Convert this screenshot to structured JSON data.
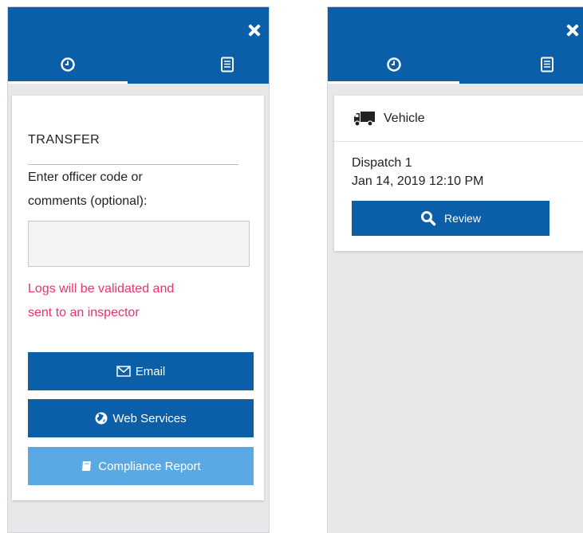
{
  "colors": {
    "header_blue": "#0b5ea8",
    "button_blue": "#0b5ea8",
    "button_light_blue": "#5aa8e4",
    "warning_pink": "#e8336c",
    "panel_background": "#e7e8ea"
  },
  "left_panel": {
    "tabs": [
      {
        "icon": "clock-icon",
        "active": true
      },
      {
        "icon": "document-icon",
        "active": false
      }
    ],
    "transfer": {
      "title": "TRANSFER",
      "prompt_line1": "Enter officer code or",
      "prompt_line2": "comments (optional):",
      "input_value": "",
      "input_placeholder": "",
      "warning_line1": "Logs will be validated and",
      "warning_line2": "sent to an inspector",
      "buttons": {
        "email": {
          "label": "Email",
          "icon": "envelope-icon"
        },
        "web_services": {
          "label": "Web Services",
          "icon": "globe-icon"
        },
        "compliance_report": {
          "label": "Compliance Report",
          "icon": "report-icon"
        }
      }
    }
  },
  "right_panel": {
    "tabs": [
      {
        "icon": "clock-icon",
        "active": true
      },
      {
        "icon": "document-icon",
        "active": false
      }
    ],
    "vehicle": {
      "section_title": "Vehicle",
      "section_icon": "truck-icon",
      "dispatch_name": "Dispatch 1",
      "dispatch_time": "Jan 14, 2019 12:10 PM",
      "review_label": "Review",
      "review_icon": "search-icon"
    }
  }
}
